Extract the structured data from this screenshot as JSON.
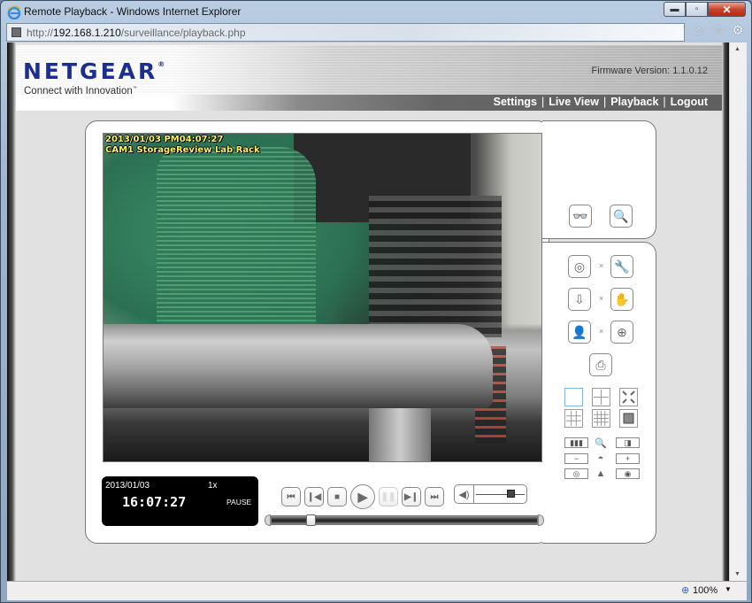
{
  "browser": {
    "title": "Remote Playback - Windows Internet Explorer",
    "url_prefix": "http://",
    "url_host": "192.168.1.210",
    "url_path": "/surveillance/playback.php",
    "window_buttons": {
      "minimize": "▬",
      "maximize": "▫",
      "close": "✕"
    },
    "toolbar_icons": [
      "home-icon",
      "favorites-star-icon",
      "tools-gear-icon"
    ],
    "zoom_level": "100%"
  },
  "header": {
    "logo": "NETGEAR",
    "logo_mark": "®",
    "tagline": "Connect with Innovation",
    "tagline_mark": "™",
    "firmware": "Firmware Version: 1.1.0.12",
    "nav": [
      {
        "label": "Settings"
      },
      {
        "label": "Live View"
      },
      {
        "label": "Playback"
      },
      {
        "label": "Logout"
      }
    ],
    "nav_separator": "|"
  },
  "video": {
    "osd_datetime": "2013/01/03 PM04:07:27",
    "osd_camera": "CAM1 StorageReview Lab Rack"
  },
  "playback_status": {
    "date": "2013/01/03",
    "speed": "1x",
    "time": "16:07:27",
    "state": "PAUSE"
  },
  "controls": {
    "buttons": [
      {
        "name": "skip-to-start",
        "glyph": "⏮"
      },
      {
        "name": "step-back",
        "glyph": "❙◀"
      },
      {
        "name": "stop",
        "glyph": "■"
      },
      {
        "name": "play",
        "glyph": "▶"
      },
      {
        "name": "pause",
        "glyph": "❚❚",
        "disabled": true
      },
      {
        "name": "step-forward",
        "glyph": "▶❙"
      },
      {
        "name": "skip-to-end",
        "glyph": "⏭"
      }
    ],
    "volume_icon": "🔈",
    "volume_level": 0.72,
    "seek_position": 0.15
  },
  "side_panel": {
    "search_buttons": [
      {
        "name": "search-binoculars",
        "glyph": "⛓"
      },
      {
        "name": "event-search",
        "glyph": "🔍"
      }
    ],
    "tool_rows": [
      {
        "left": "video-reel",
        "left_glyph": "◎",
        "right": "settings-wrench",
        "right_glyph": "🔧",
        "sep": "×"
      },
      {
        "left": "download",
        "left_glyph": "⇩",
        "right": "backup-hand",
        "right_glyph": "✋",
        "sep": "×"
      },
      {
        "left": "user-file",
        "left_glyph": "👤",
        "right": "disc-add",
        "right_glyph": "⊕",
        "sep": "×"
      }
    ],
    "print_glyph": "⎙",
    "layouts": [
      "1x1",
      "2x2",
      "fullscreen",
      "3x3",
      "4x4",
      "original-size"
    ],
    "ptz": {
      "row1": [
        "▮▮▮",
        "🔍",
        "◨"
      ],
      "row2": [
        "−",
        "◓",
        "+"
      ],
      "row3": [
        "◎",
        "▲",
        "◉"
      ]
    }
  }
}
